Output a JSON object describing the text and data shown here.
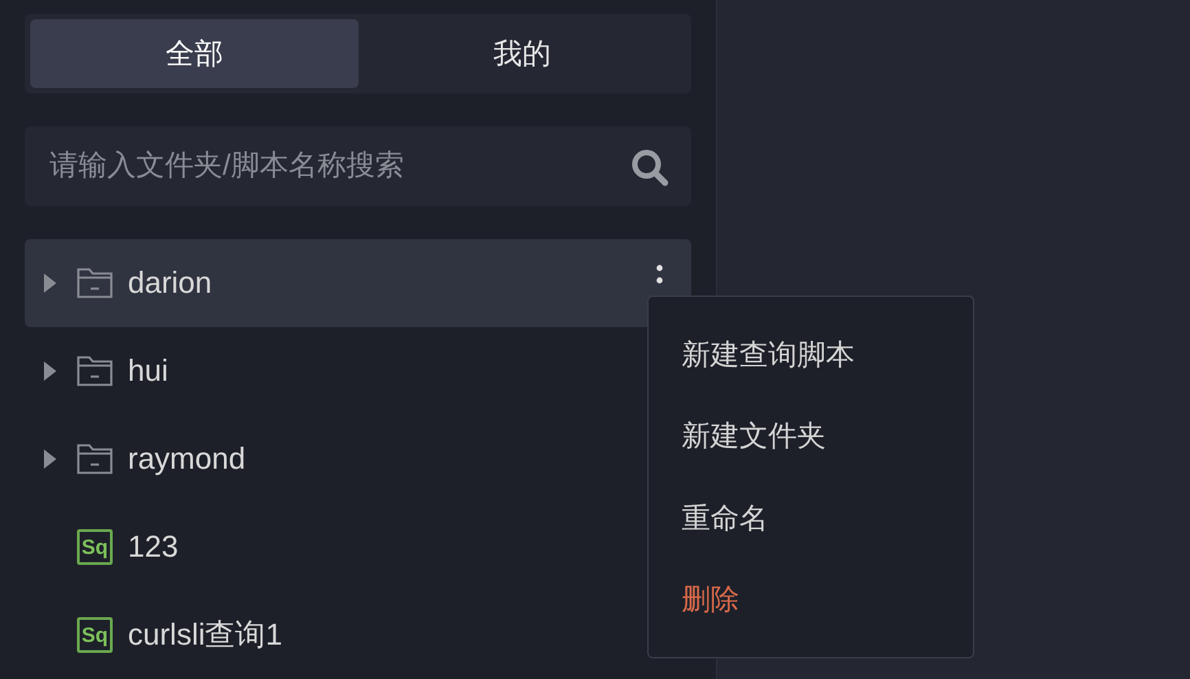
{
  "tabs": [
    {
      "label": "全部",
      "selected": true
    },
    {
      "label": "我的",
      "selected": false
    }
  ],
  "search": {
    "placeholder": "请输入文件夹/脚本名称搜索"
  },
  "tree": [
    {
      "kind": "folder",
      "name": "darion",
      "expanded": false,
      "selected": true
    },
    {
      "kind": "folder",
      "name": "hui",
      "expanded": false,
      "selected": false
    },
    {
      "kind": "folder",
      "name": "raymond",
      "expanded": false,
      "selected": false
    },
    {
      "kind": "sql",
      "name": "123",
      "badge": "Sq",
      "selected": false
    },
    {
      "kind": "sql",
      "name": "curlsli查询1",
      "badge": "Sq",
      "selected": false
    }
  ],
  "context_menu": [
    {
      "label": "新建查询脚本",
      "kind": "normal"
    },
    {
      "label": "新建文件夹",
      "kind": "normal"
    },
    {
      "label": "重命名",
      "kind": "normal"
    },
    {
      "label": "删除",
      "kind": "danger"
    }
  ]
}
